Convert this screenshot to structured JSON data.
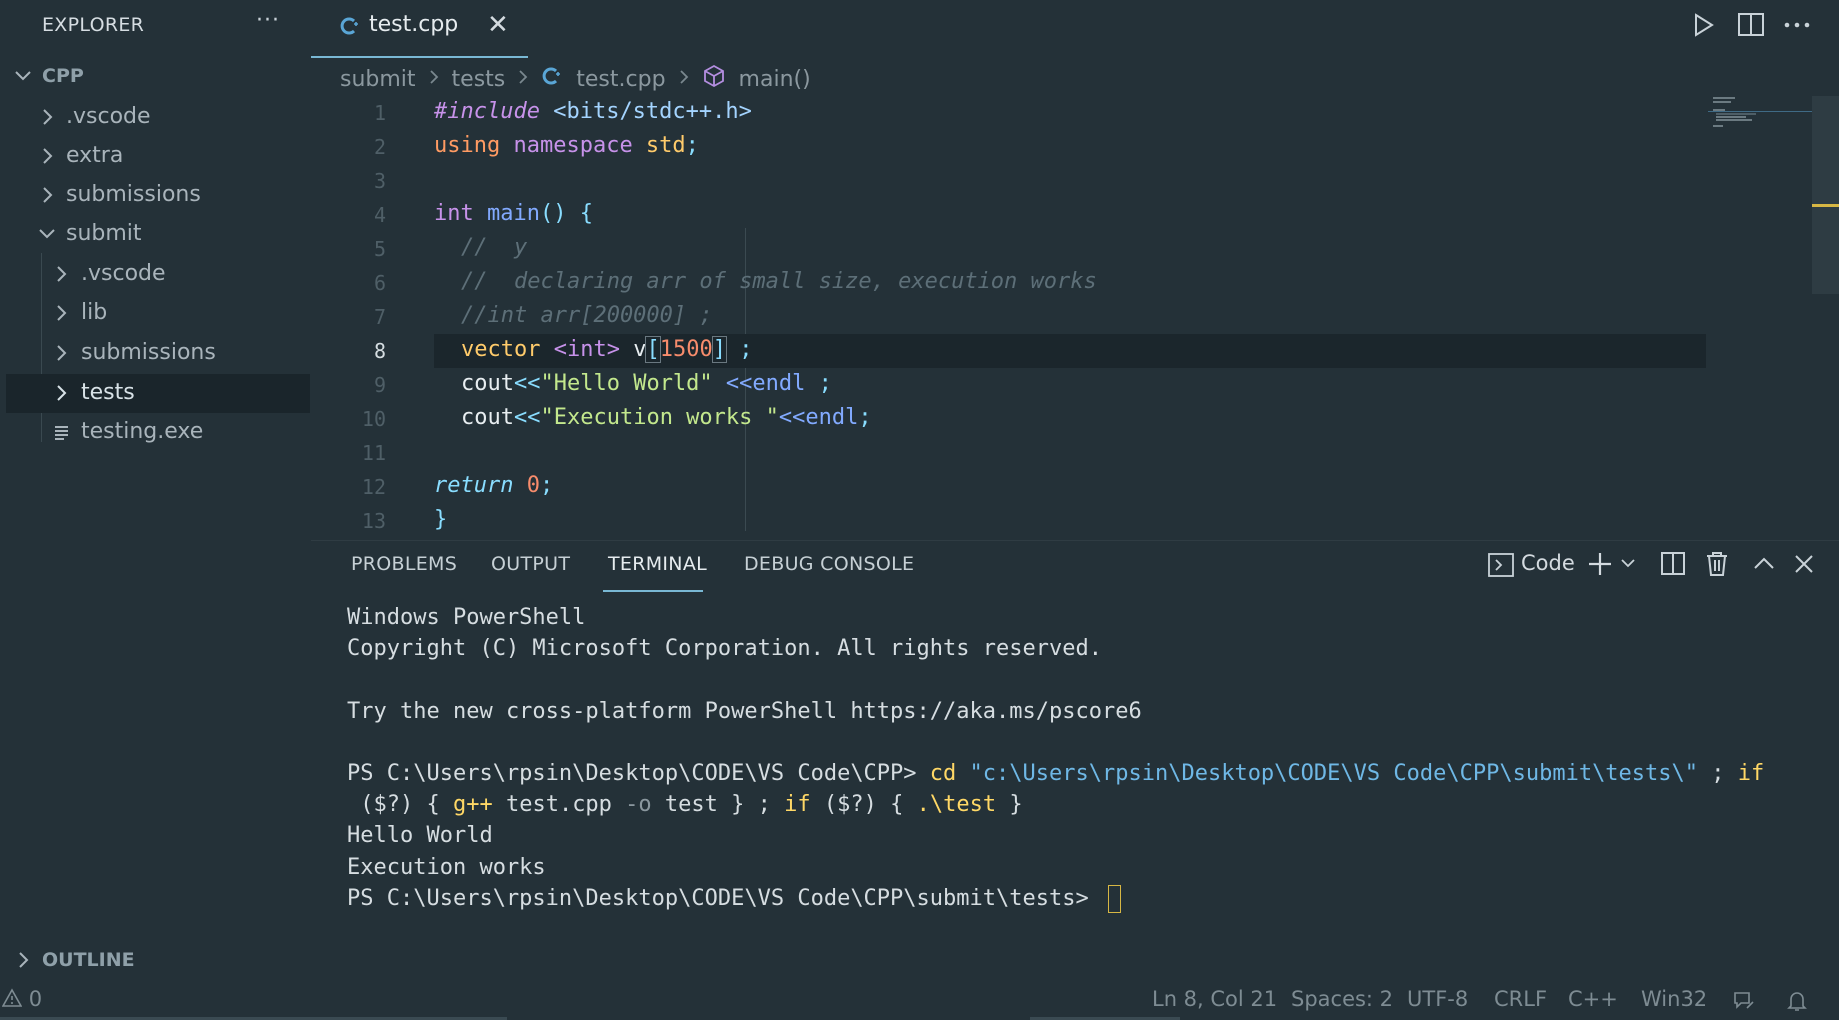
{
  "sidebar": {
    "title": "EXPLORER",
    "more_label": "···",
    "root_folder": "CPP",
    "items": [
      {
        "label": ".vscode",
        "type": "folder",
        "expanded": false,
        "depth": 1
      },
      {
        "label": "extra",
        "type": "folder",
        "expanded": false,
        "depth": 1
      },
      {
        "label": "submissions",
        "type": "folder",
        "expanded": false,
        "depth": 1
      },
      {
        "label": "submit",
        "type": "folder",
        "expanded": true,
        "depth": 1
      },
      {
        "label": ".vscode",
        "type": "folder",
        "expanded": false,
        "depth": 2
      },
      {
        "label": "lib",
        "type": "folder",
        "expanded": false,
        "depth": 2
      },
      {
        "label": "submissions",
        "type": "folder",
        "expanded": false,
        "depth": 2
      },
      {
        "label": "tests",
        "type": "folder",
        "expanded": false,
        "depth": 2,
        "selected": true
      },
      {
        "label": "testing.exe",
        "type": "file",
        "depth": 2
      }
    ],
    "outline_label": "OUTLINE"
  },
  "tabs": [
    {
      "label": "test.cpp",
      "icon": "cpp-file-icon",
      "active": true
    }
  ],
  "breadcrumb": {
    "items": [
      "submit",
      "tests",
      "test.cpp",
      "main()"
    ]
  },
  "editor": {
    "line_numbers": [
      "1",
      "2",
      "3",
      "4",
      "5",
      "6",
      "7",
      "8",
      "9",
      "10",
      "11",
      "12",
      "13"
    ],
    "current_line": "8",
    "lines": {
      "l1_include": "#include",
      "l1_header": " <bits/stdc++.h>",
      "l2_using": "using",
      "l2_namespace": " namespace",
      "l2_std": " std",
      "l2_semi": ";",
      "l4_int": "int",
      "l4_main": " main",
      "l4_rest": "() {",
      "l5": "//  y",
      "l6": "//  declaring arr of small size, execution works",
      "l7": "//int arr[200000] ;",
      "l8_vector": "vector",
      "l8_int": " <int>",
      "l8_v": " v",
      "l8_lb": "[",
      "l8_num": "1500",
      "l8_rb": "]",
      "l8_semi": " ;",
      "l9_cout": "cout",
      "l9_op": "<<",
      "l9_str": "\"Hello World\"",
      "l9_endl": " <<endl",
      "l9_semi": " ;",
      "l10_cout": "cout",
      "l10_op": "<<",
      "l10_str": "\"Execution works \"",
      "l10_endl": "<<endl",
      "l10_semi": ";",
      "l12_return": "return",
      "l12_num": " 0",
      "l12_semi": ";",
      "l13": "}"
    }
  },
  "panel": {
    "tabs": [
      "PROBLEMS",
      "OUTPUT",
      "TERMINAL",
      "DEBUG CONSOLE"
    ],
    "active_tab": "TERMINAL",
    "terminal_profile": "Code"
  },
  "terminal": {
    "line1": "Windows PowerShell",
    "line2": "Copyright (C) Microsoft Corporation. All rights reserved.",
    "line4": "Try the new cross-platform PowerShell https://aka.ms/pscore6",
    "prompt1": "PS C:\\Users\\rpsin\\Desktop\\CODE\\VS Code\\CPP> ",
    "cmd_cd": "cd",
    "cmd_path": " \"c:\\Users\\rpsin\\Desktop\\CODE\\VS Code\\CPP\\submit\\tests\\\"",
    "cmd_sep1": " ; ",
    "cmd_if1": "if",
    "cmd_cont_open": " ($?) { ",
    "cmd_gpp": "g++",
    "cmd_file": " test.cpp ",
    "cmd_flag": "-o",
    "cmd_out": " test } ; ",
    "cmd_if2": "if",
    "cmd_cond2": " ($?) { ",
    "cmd_run": ".\\test",
    "cmd_close": " }",
    "out1": "Hello World",
    "out2": "Execution works",
    "prompt2": "PS C:\\Users\\rpsin\\Desktop\\CODE\\VS Code\\CPP\\submit\\tests> "
  },
  "statusbar": {
    "warnings": "0",
    "position": "Ln 8, Col 21",
    "spaces": "Spaces: 2",
    "encoding": "UTF-8",
    "eol": "CRLF",
    "language": "C++",
    "platform": "Win32"
  },
  "colors": {
    "background": "#243138",
    "accent": "#79b8d4",
    "cursor": "#d7b744"
  }
}
